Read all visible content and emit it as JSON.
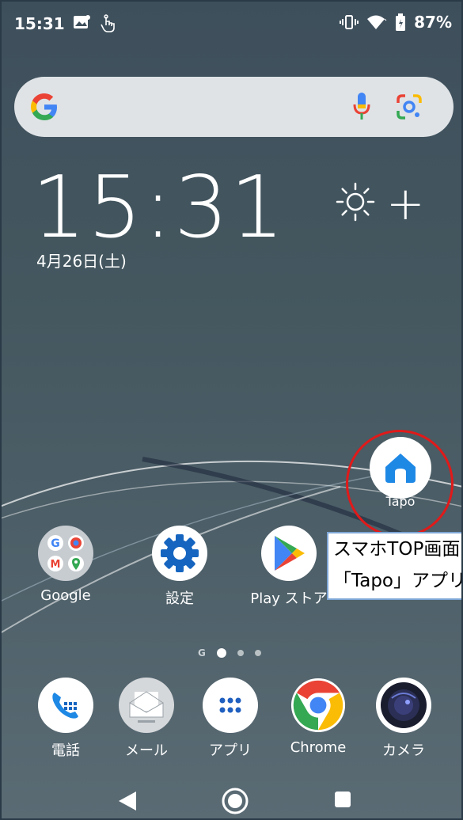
{
  "status_bar": {
    "time": "15:31",
    "battery": "87%"
  },
  "clock": {
    "time": "15:31",
    "date": "4月26日(土)"
  },
  "weather": {
    "add_symbol": "+"
  },
  "tapo": {
    "label": "Tapo"
  },
  "callout": {
    "line1": "スマホTOP画面の",
    "line2": "「Tapo」アプリをタップ"
  },
  "apps_row1": [
    {
      "label": "Google"
    },
    {
      "label": "設定"
    },
    {
      "label": "Play ストア"
    }
  ],
  "dock": [
    {
      "label": "電話"
    },
    {
      "label": "メール"
    },
    {
      "label": "アプリ"
    },
    {
      "label": "Chrome"
    },
    {
      "label": "カメラ"
    }
  ],
  "page_indicator": {
    "google_letter": "G"
  },
  "colors": {
    "highlight_circle": "#e01a1a",
    "callout_border": "#7ea6d6",
    "tapo_icon": "#1e88e5"
  }
}
